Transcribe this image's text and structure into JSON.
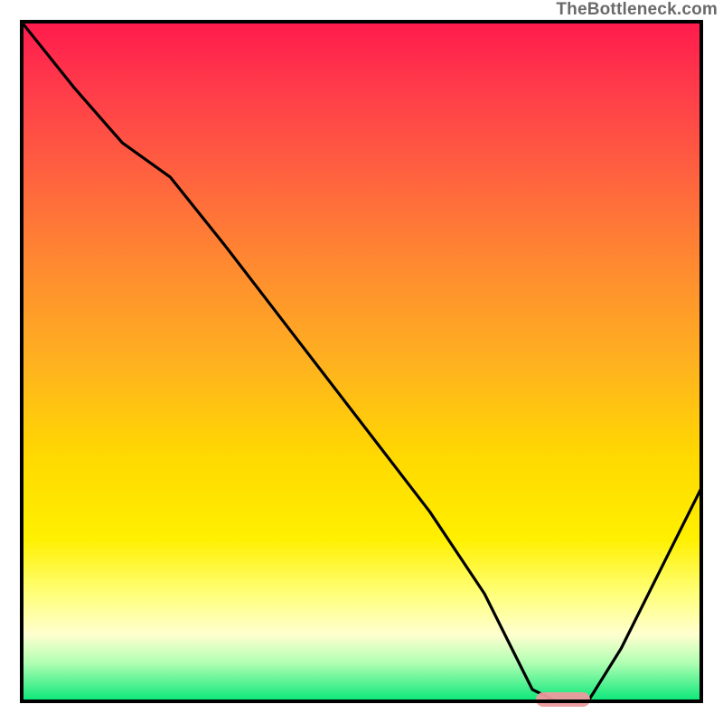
{
  "header": {
    "site": "TheBottleneck.com"
  },
  "colors": {
    "border": "#000000",
    "curve": "#000000",
    "header_text": "#6a6a6a",
    "marker": "#ed9a9e",
    "gradient_top": "#ff1a4d",
    "gradient_bottom": "#00e676"
  },
  "chart_data": {
    "type": "line",
    "title": "",
    "xlabel": "",
    "ylabel": "",
    "xlim": [
      0,
      100
    ],
    "ylim": [
      0,
      100
    ],
    "grid": false,
    "legend": false,
    "background": "vertical-gradient",
    "series": [
      {
        "name": "bottleneck-curve",
        "x": [
          0,
          8,
          15,
          22,
          30,
          40,
          50,
          60,
          68,
          72,
          75,
          79,
          83,
          88,
          94,
          100
        ],
        "values": [
          100,
          90,
          82,
          77,
          67,
          54,
          41,
          28,
          16,
          8,
          2,
          0,
          0,
          8,
          20,
          32
        ]
      }
    ],
    "annotations": [
      {
        "name": "optimal-range-marker",
        "shape": "pill",
        "x_start": 75.5,
        "x_end": 83.5,
        "y": 0.5,
        "color": "#ed9a9e"
      }
    ]
  }
}
